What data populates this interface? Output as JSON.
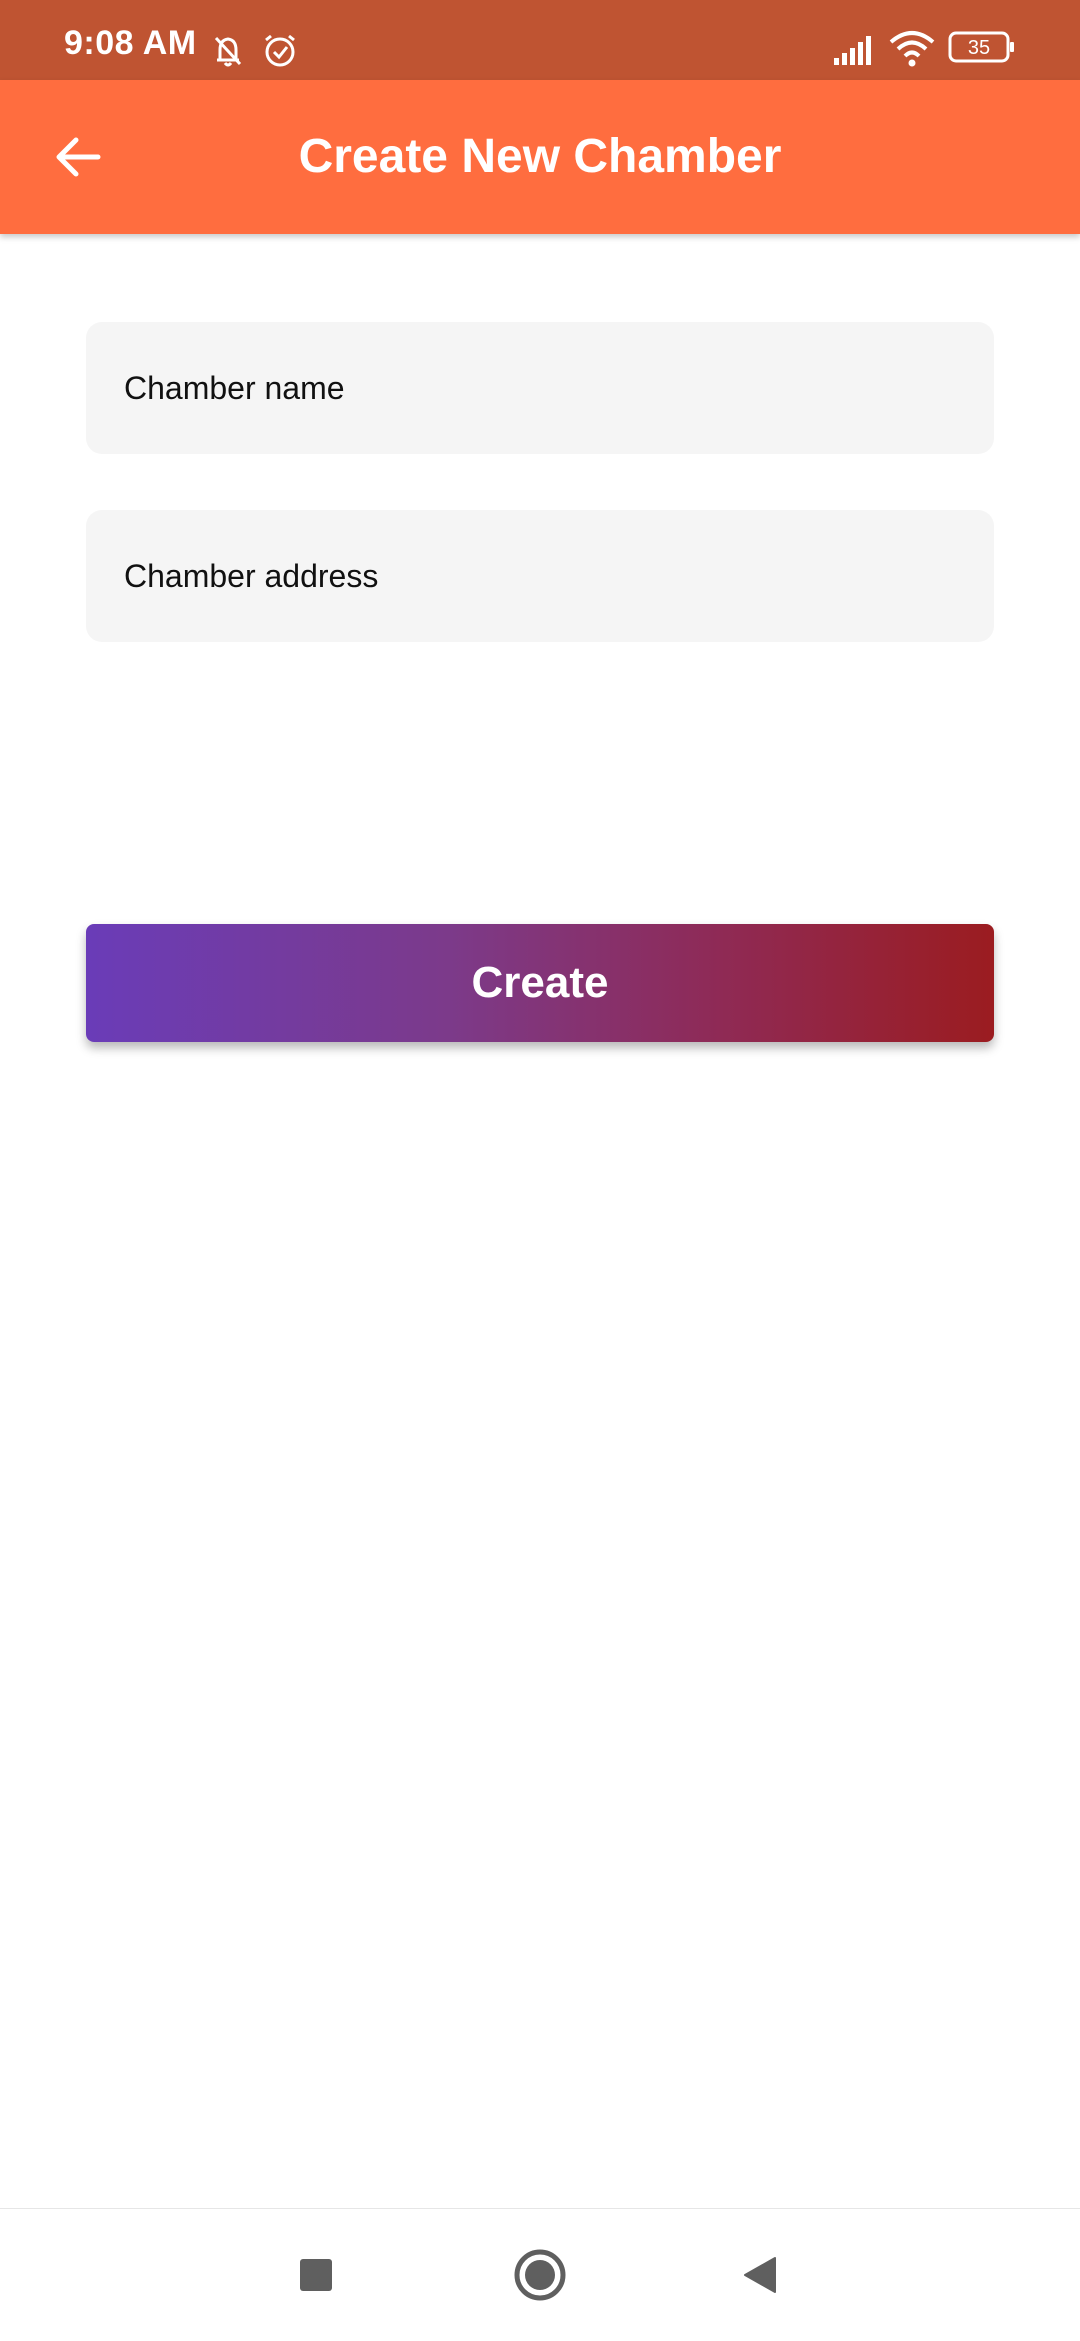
{
  "status_bar": {
    "time": "9:08 AM",
    "icons": [
      "bell-off-icon",
      "alarm-icon",
      "signal-icon",
      "wifi-icon",
      "battery-icon"
    ],
    "battery_level": "35"
  },
  "app_bar": {
    "title": "Create New Chamber",
    "back_icon": "arrow-left-icon",
    "color": "#ff6d3f"
  },
  "form": {
    "chamber_name": {
      "value": "",
      "placeholder": "Chamber name"
    },
    "chamber_address": {
      "value": "",
      "placeholder": "Chamber address"
    }
  },
  "create_button": {
    "label": "Create",
    "gradient": [
      "#6a3cb8",
      "#9b1c20"
    ]
  },
  "nav_bar": {
    "buttons": [
      "recents-square-icon",
      "home-circle-icon",
      "back-triangle-icon"
    ]
  }
}
